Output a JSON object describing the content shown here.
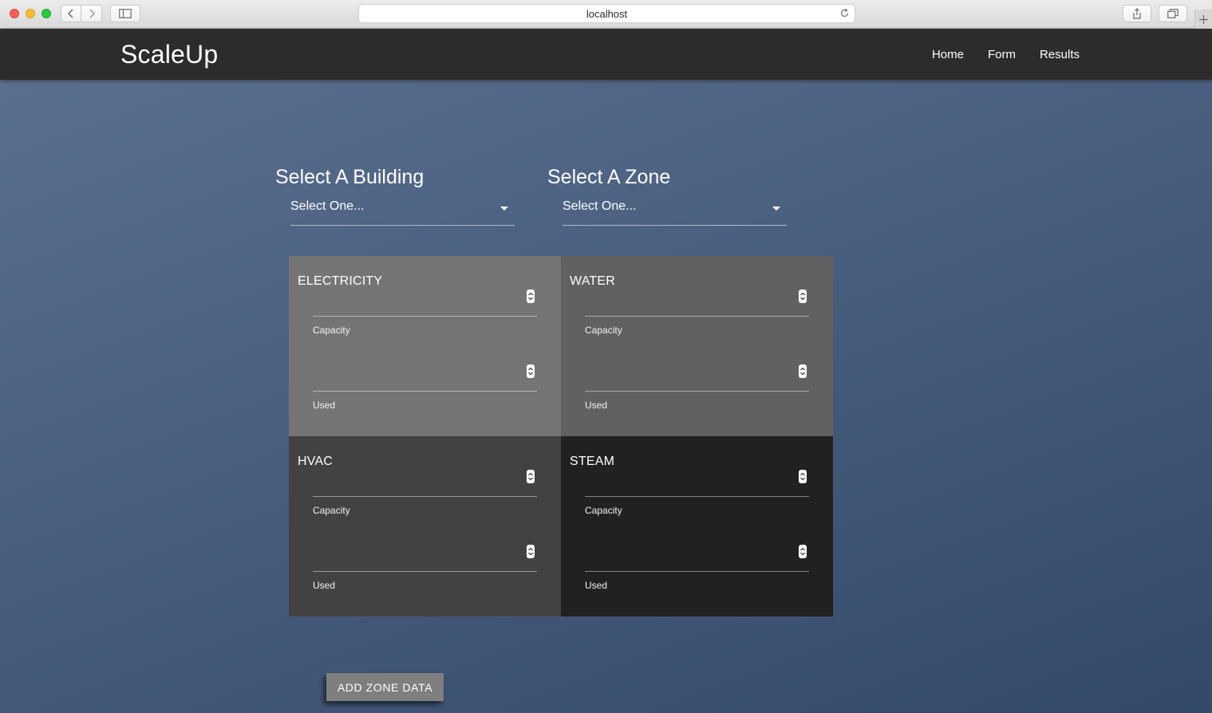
{
  "browser": {
    "url": "localhost"
  },
  "app": {
    "brand": "ScaleUp",
    "nav": [
      {
        "label": "Home"
      },
      {
        "label": "Form"
      },
      {
        "label": "Results"
      }
    ]
  },
  "selectors": {
    "building": {
      "heading": "Select A Building",
      "value": "Select One..."
    },
    "zone": {
      "heading": "Select A Zone",
      "value": "Select One..."
    }
  },
  "cards": [
    {
      "title": "ELECTRICITY",
      "capacity_label": "Capacity",
      "used_label": "Used",
      "color": "#757575"
    },
    {
      "title": "WATER",
      "capacity_label": "Capacity",
      "used_label": "Used",
      "color": "#616161"
    },
    {
      "title": "HVAC",
      "capacity_label": "Capacity",
      "used_label": "Used",
      "color": "#424242"
    },
    {
      "title": "STEAM",
      "capacity_label": "Capacity",
      "used_label": "Used",
      "color": "#212121"
    }
  ],
  "actions": {
    "add_zone_data": "ADD ZONE DATA"
  },
  "icons": {
    "back": "chevron-left-icon",
    "forward": "chevron-right-icon",
    "sidebar": "sidebar-icon",
    "reload": "reload-icon",
    "share": "share-icon",
    "tabs": "tabs-icon",
    "new_tab": "plus-icon",
    "dropdown": "caret-down-icon",
    "spinner": "spinner-arrows-icon"
  }
}
